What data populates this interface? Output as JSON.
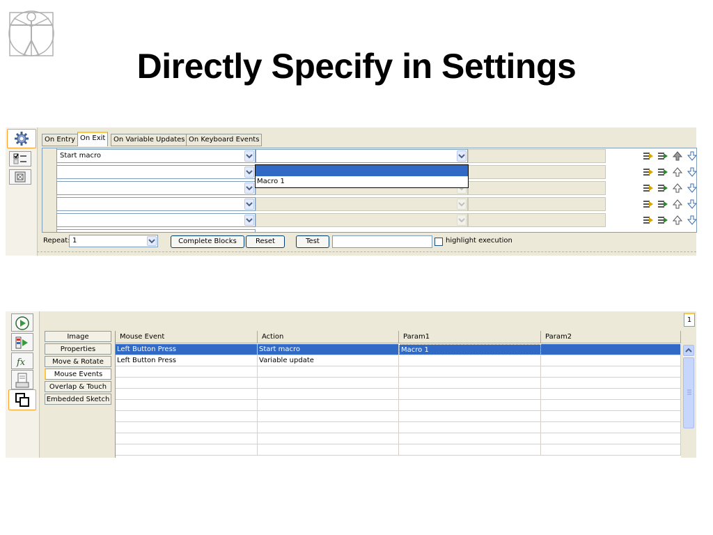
{
  "slide": {
    "title": "Directly Specify in Settings"
  },
  "macro_panel": {
    "tabs": [
      {
        "label": "On Entry",
        "active": false
      },
      {
        "label": "On Exit",
        "active": true
      },
      {
        "label": "On Variable Updates",
        "active": false
      },
      {
        "label": "On Keyboard Events",
        "active": false
      }
    ],
    "rows": [
      {
        "action": "Start macro",
        "param": ""
      },
      {
        "action": "",
        "param": ""
      },
      {
        "action": "",
        "param": ""
      },
      {
        "action": "",
        "param": ""
      },
      {
        "action": "",
        "param": ""
      }
    ],
    "dropdown_options": [
      "",
      "Macro 1"
    ],
    "repeat_label": "Repeat:",
    "repeat_value": "1",
    "complete_blocks_label": "Complete Blocks",
    "reset_label": "Reset",
    "test_label": "Test",
    "test_input_value": "",
    "highlight_label": "highlight execution",
    "highlight_checked": false
  },
  "events_panel": {
    "side_tabs": [
      {
        "label": "Image",
        "active": false
      },
      {
        "label": "Properties",
        "active": false
      },
      {
        "label": "Move & Rotate",
        "active": false
      },
      {
        "label": "Mouse Events",
        "active": true
      },
      {
        "label": "Overlap & Touch",
        "active": false
      },
      {
        "label": "Embedded Sketch",
        "active": false
      }
    ],
    "columns": [
      "Mouse Event",
      "Action",
      "Param1",
      "Param2"
    ],
    "rows": [
      {
        "event": "Left Button Press",
        "action": "Start macro",
        "param1": "Macro 1",
        "param2": "",
        "selected": true
      },
      {
        "event": "Left Button Press",
        "action": "Variable update",
        "param1": "",
        "param2": "",
        "selected": false
      }
    ],
    "corner_tab_label": "1"
  },
  "colors": {
    "selection": "#316ac5",
    "panel_bg": "#ece9d8",
    "active_tab_accent": "#ffc83c",
    "field_border": "#7f9db9"
  }
}
